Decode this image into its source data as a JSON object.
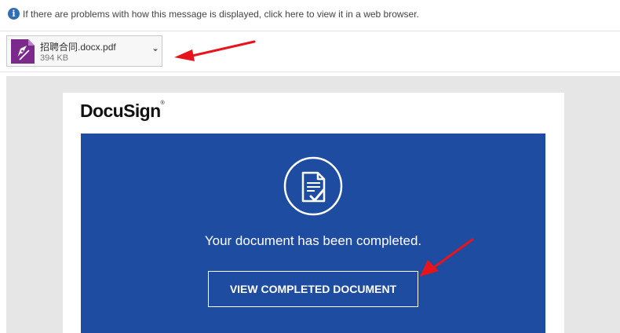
{
  "info_bar": {
    "icon": "info-icon",
    "icon_glyph": "i",
    "text": "If there are problems with how this message is displayed, click here to view it in a web browser."
  },
  "attachment": {
    "icon": "pdf-file-icon",
    "name": "招聘合同.docx.pdf",
    "size": "394 KB",
    "menu_icon": "chevron-down-icon"
  },
  "email": {
    "logo": "DocuSign",
    "logo_mark": "®",
    "status_icon": "document-check-icon",
    "message": "Your document has been completed.",
    "button_label": "VIEW COMPLETED DOCUMENT"
  },
  "colors": {
    "panel_blue": "#1e4ca1",
    "arrow_red": "#e8141b",
    "pdf_purple": "#7b2a8c"
  }
}
